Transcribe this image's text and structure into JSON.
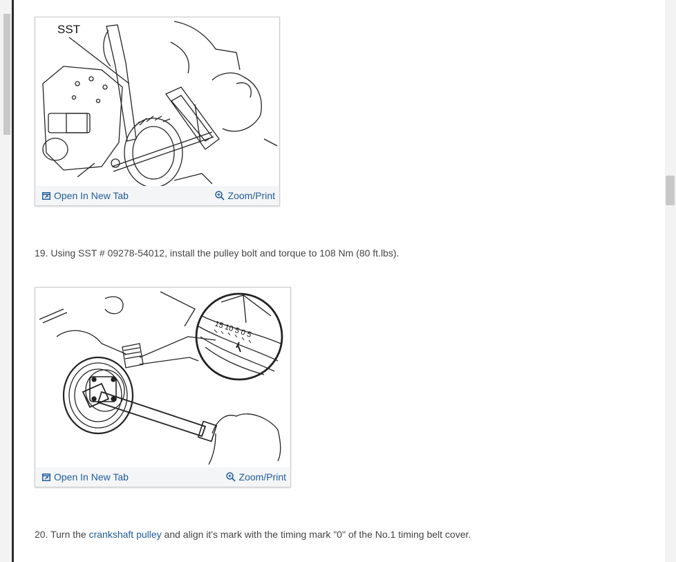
{
  "figures": [
    {
      "callout_label": "SST",
      "open_label": "Open In New Tab",
      "zoom_label": "Zoom/Print",
      "open_icon": "open-in-new-tab-icon",
      "zoom_icon": "magnifier-plus-icon"
    },
    {
      "dial_label": "15 10 5 0 5",
      "open_label": "Open In New Tab",
      "zoom_label": "Zoom/Print",
      "open_icon": "open-in-new-tab-icon",
      "zoom_icon": "magnifier-plus-icon"
    }
  ],
  "steps": [
    {
      "text": "19. Using SST # 09278-54012, install the pulley bolt and torque to 108 Nm (80 ft.lbs)."
    },
    {
      "prefix": "20. Turn the ",
      "link": "crankshaft pulley",
      "suffix": " and align it's mark with the timing mark \"0\" of the No.1 timing belt cover."
    }
  ],
  "colors": {
    "link": "#1f5c99",
    "body_text": "#444444",
    "figure_bar": "#f4f5f7"
  }
}
